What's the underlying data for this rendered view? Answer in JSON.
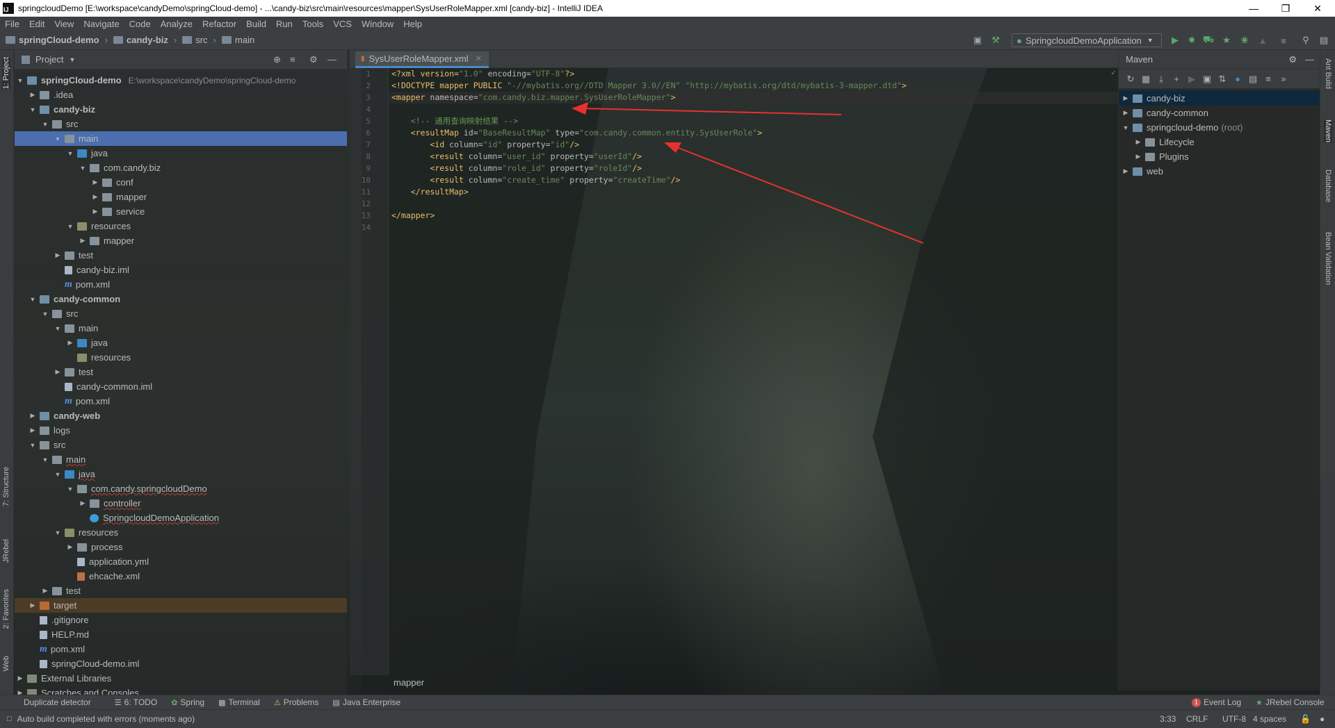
{
  "window": {
    "title": "springcloudDemo [E:\\workspace\\candyDemo\\springCloud-demo] - ...\\candy-biz\\src\\main\\resources\\mapper\\SysUserRoleMapper.xml [candy-biz] - IntelliJ IDEA"
  },
  "menu": [
    "File",
    "Edit",
    "View",
    "Navigate",
    "Code",
    "Analyze",
    "Refactor",
    "Build",
    "Run",
    "Tools",
    "VCS",
    "Window",
    "Help"
  ],
  "navbar": {
    "crumbs": [
      "springCloud-demo",
      "candy-biz",
      "src",
      "main"
    ],
    "run_config": "SpringcloudDemoApplication"
  },
  "project_panel": {
    "title": "Project",
    "rows": [
      {
        "label": "springCloud-demo",
        "hint": "E:\\workspace\\candyDemo\\springCloud-demo"
      },
      {
        "label": ".idea"
      },
      {
        "label": "candy-biz"
      },
      {
        "label": "src"
      },
      {
        "label": "main"
      },
      {
        "label": "java"
      },
      {
        "label": "com.candy.biz"
      },
      {
        "label": "conf"
      },
      {
        "label": "mapper"
      },
      {
        "label": "service"
      },
      {
        "label": "resources"
      },
      {
        "label": "mapper"
      },
      {
        "label": "test"
      },
      {
        "label": "candy-biz.iml"
      },
      {
        "label": "pom.xml"
      },
      {
        "label": "candy-common"
      },
      {
        "label": "src"
      },
      {
        "label": "main"
      },
      {
        "label": "java"
      },
      {
        "label": "resources"
      },
      {
        "label": "test"
      },
      {
        "label": "candy-common.iml"
      },
      {
        "label": "pom.xml"
      },
      {
        "label": "candy-web"
      },
      {
        "label": "logs"
      },
      {
        "label": "src"
      },
      {
        "label": "main"
      },
      {
        "label": "java"
      },
      {
        "label": "com.candy.springcloudDemo"
      },
      {
        "label": "controller"
      },
      {
        "label": "SpringcloudDemoApplication"
      },
      {
        "label": "resources"
      },
      {
        "label": "process"
      },
      {
        "label": "application.yml"
      },
      {
        "label": "ehcache.xml"
      },
      {
        "label": "test"
      },
      {
        "label": "target"
      },
      {
        "label": ".gitignore"
      },
      {
        "label": "HELP.md"
      },
      {
        "label": "pom.xml"
      },
      {
        "label": "springCloud-demo.iml"
      },
      {
        "label": "External Libraries"
      },
      {
        "label": "Scratches and Consoles"
      }
    ]
  },
  "editor": {
    "tab": "SysUserRoleMapper.xml",
    "line_numbers": [
      "1",
      "2",
      "3",
      "4",
      "5",
      "6",
      "7",
      "8",
      "9",
      "10",
      "11",
      "12",
      "13",
      "14"
    ],
    "lines": {
      "l1": {
        "a": "<?xml version=",
        "b": "\"1.0\"",
        "c": " encoding=",
        "d": "\"UTF-8\"",
        "e": "?>"
      },
      "l2": {
        "a": "<!DOCTYPE mapper PUBLIC ",
        "b": "\"-//mybatis.org//DTD Mapper 3.0//EN\"",
        "c": " ",
        "d": "\"http://mybatis.org/dtd/mybatis-3-mapper.dtd\"",
        "e": ">"
      },
      "l3": {
        "a": "<mapper ",
        "b": "namespace=",
        "c": "\"com.candy.biz.mapper.SysUserRoleMapper\"",
        "d": ">"
      },
      "l5": {
        "a": "    <!-- 通用查询映射结果 -->"
      },
      "l6": {
        "a": "    <resultMap ",
        "b": "id=",
        "c": "\"BaseResultMap\"",
        "d": " type=",
        "e": "\"com.candy.common.entity.SysUserRole\"",
        "f": ">"
      },
      "l7": {
        "a": "        <id ",
        "b": "column=",
        "c": "\"id\"",
        "d": " property=",
        "e": "\"id\"",
        "f": "/>"
      },
      "l8": {
        "a": "        <result ",
        "b": "column=",
        "c": "\"user_id\"",
        "d": " property=",
        "e": "\"userId\"",
        "f": "/>"
      },
      "l9": {
        "a": "        <result ",
        "b": "column=",
        "c": "\"role_id\"",
        "d": " property=",
        "e": "\"roleId\"",
        "f": "/>"
      },
      "l10": {
        "a": "        <result ",
        "b": "column=",
        "c": "\"create_time\"",
        "d": " property=",
        "e": "\"createTime\"",
        "f": "/>"
      },
      "l11": {
        "a": "    </resultMap>"
      },
      "l13": {
        "a": "</mapper>"
      }
    },
    "breadcrumb": "mapper"
  },
  "maven_panel": {
    "title": "Maven",
    "rows": [
      {
        "label": "candy-biz"
      },
      {
        "label": "candy-common"
      },
      {
        "label": "springcloud-demo",
        "hint": "(root)"
      },
      {
        "label": "Lifecycle"
      },
      {
        "label": "Plugins"
      },
      {
        "label": "web"
      }
    ]
  },
  "left_tools": [
    "1: Project",
    "7: Structure",
    "JRebel",
    "2: Favorites",
    "Web"
  ],
  "right_tools": [
    "Ant Build",
    "Maven",
    "Database",
    "Bean Validation"
  ],
  "bottom_tools": {
    "left": [
      "Duplicate detector",
      "6: TODO",
      "Spring",
      "Terminal",
      "Problems",
      "Java Enterprise"
    ],
    "right": [
      "Event Log",
      "JRebel Console"
    ],
    "event_count": "1"
  },
  "status": {
    "message": "Auto build completed with errors (moments ago)",
    "position": "3:33",
    "line_sep": "CRLF",
    "encoding": "UTF-8",
    "indent": "4 spaces"
  },
  "colors": {
    "selection": "#4b6eaf",
    "annotation_arrow": "#e8312f",
    "xml_tag": "#e8bf6a",
    "xml_value": "#6a8759"
  }
}
